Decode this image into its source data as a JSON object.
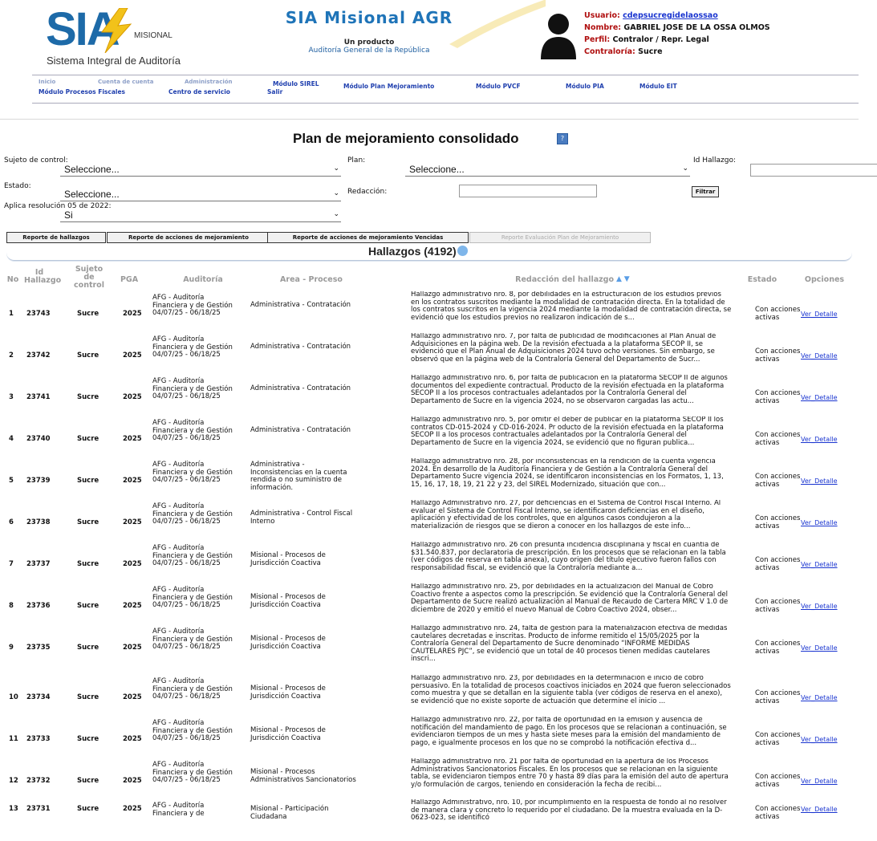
{
  "header": {
    "logo_text": "SIA",
    "logo_misional": "MISIONAL",
    "logo_subtitle": "Sistema Integral de Auditoría",
    "app_title": "SIA Misional AGR",
    "app_sub1": "Un producto",
    "app_sub2": "Auditoría General de la República",
    "user": {
      "usuario_label": "Usuario:",
      "usuario_value": "cdepsucregidelaossao",
      "nombre_label": "Nombre:",
      "nombre_value": "GABRIEL JOSE DE LA OSSA OLMOS",
      "perfil_label": "Perfil:",
      "perfil_value": "Contralor / Repr. Legal",
      "contraloria_label": "Contraloría:",
      "contraloria_value": "Sucre"
    }
  },
  "nav": {
    "row1": [
      "Inicio",
      "Cuenta de cuenta",
      "Administración",
      "Módulo SIREL",
      "Módulo Plan Mejoramiento",
      "Módulo PVCF",
      "Módulo PIA",
      "Módulo EIT"
    ],
    "row2": [
      "Módulo Procesos Fiscales",
      "Centro de servicio",
      "Salir"
    ]
  },
  "page": {
    "title": "Plan de mejoramiento consolidado"
  },
  "filters": {
    "sujeto_label": "Sujeto de control:",
    "sujeto_value": "Seleccione...",
    "plan_label": "Plan:",
    "plan_value": "Seleccione...",
    "id_hallazgo_label": "Id Hallazgo:",
    "estado_label": "Estado:",
    "estado_value": "Seleccione...",
    "redaccion_label": "Redacción:",
    "filtrar_label": "Filtrar",
    "aplica_label": "Aplica resolución 05 de 2022:",
    "aplica_value": "Si"
  },
  "buttons": {
    "reporte_hallazgos": "Reporte de hallazgos",
    "reporte_acciones": "Reporte de acciones de mejoramiento",
    "reporte_vencidas": "Reporte de acciones de mejoramiento Vencidas",
    "reporte_evaluacion": "Reporte Evaluación Plan de Mejoramiento"
  },
  "section": {
    "title": "Hallazgos (4192)"
  },
  "table": {
    "headers": {
      "no": "No",
      "id": "Id Hallazgo",
      "sujeto": "Sujeto de control",
      "pga": "PGA",
      "auditoria": "Auditoría",
      "area": "Area - Proceso",
      "redaccion": "Redacción del hallazgo",
      "estado": "Estado",
      "opciones": "Opciones"
    },
    "rows": [
      {
        "no": "1",
        "id": "23743",
        "sujeto": "Sucre",
        "pga": "2025",
        "auditoria": "AFG - Auditoría Financiera y de Gestión 04/07/25 - 06/18/25",
        "area": "Administrativa - Contratación",
        "redaccion": "Hallazgo administrativo nro. 8, por debilidades en la estructuración de los estudios previos en los contratos suscritos mediante la modalidad de contratación directa. En la totalidad de los contratos suscritos en la vigencia 2024 mediante la modalidad de contratación directa, se evidenció que los estudios previos no realizaron indicación de s...",
        "estado": "Con acciones activas",
        "opcion": "Ver_Detalle"
      },
      {
        "no": "2",
        "id": "23742",
        "sujeto": "Sucre",
        "pga": "2025",
        "auditoria": "AFG - Auditoría Financiera y de Gestión 04/07/25 - 06/18/25",
        "area": "Administrativa - Contratación",
        "redaccion": "Hallazgo administrativo nro. 7, por falta de publicidad de modificaciones al Plan Anual de Adquisiciones en la página web. De la revisión efectuada a la plataforma SECOP II, se evidenció que el Plan Anual de Adquisiciones 2024 tuvo ocho versiones. Sin embargo, se observó que en la página web de la Contraloría General del Departamento de Sucr...",
        "estado": "Con acciones activas",
        "opcion": "Ver_Detalle"
      },
      {
        "no": "3",
        "id": "23741",
        "sujeto": "Sucre",
        "pga": "2025",
        "auditoria": "AFG - Auditoría Financiera y de Gestión 04/07/25 - 06/18/25",
        "area": "Administrativa - Contratación",
        "redaccion": "Hallazgo administrativo nro. 6, por falta de publicación en la plataforma SECOP II de algunos documentos del expediente contractual. Producto de la revisión efectuada en la plataforma SECOP II a los procesos contractuales adelantados por la Contraloría General del Departamento de Sucre en la vigencia 2024, no se observaron cargadas las actu...",
        "estado": "Con acciones activas",
        "opcion": "Ver_Detalle"
      },
      {
        "no": "4",
        "id": "23740",
        "sujeto": "Sucre",
        "pga": "2025",
        "auditoria": "AFG - Auditoría Financiera y de Gestión 04/07/25 - 06/18/25",
        "area": "Administrativa - Contratación",
        "redaccion": "Hallazgo administrativo nro. 5, por omitir el deber de publicar en la plataforma SECOP II los contratos CD-015-2024 y CD-016-2024. Pr oducto de la revisión efectuada en la plataforma SECOP II a los procesos contractuales adelantados por la Contraloría General del Departamento de Sucre en la vigencia 2024, se evidenció que no figuran publica...",
        "estado": "Con acciones activas",
        "opcion": "Ver_Detalle"
      },
      {
        "no": "5",
        "id": "23739",
        "sujeto": "Sucre",
        "pga": "2025",
        "auditoria": "AFG - Auditoría Financiera y de Gestión 04/07/25 - 06/18/25",
        "area": "Administrativa - Inconsistencias en la cuenta rendida o no suministro de información.",
        "redaccion": "Hallazgo administrativo nro. 28, por inconsistencias en la rendición de la cuenta vigencia 2024. En desarrollo de la Auditoría Financiera y de Gestión a la Contraloría General del Departamento Sucre vigencia 2024, se identificaron inconsistencias en los Formatos, 1, 13, 15, 16, 17, 18, 19, 21 22 y 23, del SIREL Modernizado, situación que con...",
        "estado": "Con acciones activas",
        "opcion": "Ver_Detalle"
      },
      {
        "no": "6",
        "id": "23738",
        "sujeto": "Sucre",
        "pga": "2025",
        "auditoria": "AFG - Auditoría Financiera y de Gestión 04/07/25 - 06/18/25",
        "area": "Administrativa - Control Fiscal Interno",
        "redaccion": "Hallazgo Administrativo nro. 27, por deficiencias en el Sistema de Control Fiscal Interno. Al evaluar el Sistema de Control Fiscal Interno, se identificaron deficiencias en el diseño, aplicación y efectividad de los controles, que en algunos casos condujeron a la materialización de riesgos que se dieron a conocer en los hallazgos de este info...",
        "estado": "Con acciones activas",
        "opcion": "Ver_Detalle"
      },
      {
        "no": "7",
        "id": "23737",
        "sujeto": "Sucre",
        "pga": "2025",
        "auditoria": "AFG - Auditoría Financiera y de Gestión 04/07/25 - 06/18/25",
        "area": "Misional - Procesos de Jurisdicción Coactiva",
        "redaccion": "Hallazgo administrativo nro. 26 con presunta incidencia disciplinaria y fiscal en cuantía de $31.540.837, por declaratoria de prescripción. En los procesos que se relacionan en la tabla (ver códigos de reserva en tabla anexa), cuyo origen del título ejecutivo fueron fallos con responsabilidad fiscal, se evidenció que la Contraloría mediante a...",
        "estado": "Con acciones activas",
        "opcion": "Ver_Detalle"
      },
      {
        "no": "8",
        "id": "23736",
        "sujeto": "Sucre",
        "pga": "2025",
        "auditoria": "AFG - Auditoría Financiera y de Gestión 04/07/25 - 06/18/25",
        "area": "Misional - Procesos de Jurisdicción Coactiva",
        "redaccion": "Hallazgo administrativo nro. 25, por debilidades en la actualización del Manual de Cobro Coactivo frente a aspectos como la prescripción. Se evidenció que la Contraloría General del Departamento de Sucre realizó actualización al Manual de Recaudo de Cartera MRC V 1.0 de diciembre de 2020 y emitió el nuevo Manual de Cobro Coactivo 2024, obser...",
        "estado": "Con acciones activas",
        "opcion": "Ver_Detalle"
      },
      {
        "no": "9",
        "id": "23735",
        "sujeto": "Sucre",
        "pga": "2025",
        "auditoria": "AFG - Auditoría Financiera y de Gestión 04/07/25 - 06/18/25",
        "area": "Misional - Procesos de Jurisdicción Coactiva",
        "redaccion": "Hallazgo administrativo nro. 24, falta de gestión para la materialización efectiva de medidas cautelares decretadas e inscritas. Producto de informe remitido el 15/05/2025 por la Contraloría General del Departamento de Sucre denominado “INFORME MEDIDAS CAUTELARES PJC”, se evidenció que un total de 40 procesos tienen medidas cautelares inscri...",
        "estado": "Con acciones activas",
        "opcion": "Ver_Detalle"
      },
      {
        "no": "10",
        "id": "23734",
        "sujeto": "Sucre",
        "pga": "2025",
        "auditoria": "AFG - Auditoría Financiera y de Gestión 04/07/25 - 06/18/25",
        "area": "Misional - Procesos de Jurisdicción Coactiva",
        "redaccion": "Hallazgo administrativo nro. 23, por debilidades en la determinación e inicio de cobro persuasivo. En la totalidad de procesos coactivos iniciados en 2024 que fueron seleccionados como muestra y que se detallan en la siguiente tabla (ver códigos de reserva en el anexo), se evidenció que no existe soporte de actuación que determine el inicio ...",
        "estado": "Con acciones activas",
        "opcion": "Ver_Detalle"
      },
      {
        "no": "11",
        "id": "23733",
        "sujeto": "Sucre",
        "pga": "2025",
        "auditoria": "AFG - Auditoría Financiera y de Gestión 04/07/25 - 06/18/25",
        "area": "Misional - Procesos de Jurisdicción Coactiva",
        "redaccion": "Hallazgo administrativo nro. 22, por falta de oportunidad en la emisión y ausencia de notificación del mandamiento de pago. En los procesos que se relacionan a continuación, se evidenciaron tiempos de un mes y hasta siete meses para la emisión del mandamiento de pago, e igualmente procesos en los que no se comprobó la notificación efectiva d...",
        "estado": "Con acciones activas",
        "opcion": "Ver_Detalle"
      },
      {
        "no": "12",
        "id": "23732",
        "sujeto": "Sucre",
        "pga": "2025",
        "auditoria": "AFG - Auditoría Financiera y de Gestión 04/07/25 - 06/18/25",
        "area": "Misional - Procesos Administrativos Sancionatorios",
        "redaccion": "Hallazgo administrativo nro. 21 por falta de oportunidad en la apertura de los Procesos Administrativos Sancionatorios Fiscales. En los procesos que se relacionan en la siguiente tabla, se evidenciaron tiempos entre 70 y hasta 89 días para la emisión del auto de apertura y/o formulación de cargos, teniendo en consideración la fecha de recibi...",
        "estado": "Con acciones activas",
        "opcion": "Ver_Detalle"
      },
      {
        "no": "13",
        "id": "23731",
        "sujeto": "Sucre",
        "pga": "2025",
        "auditoria": "AFG - Auditoría Financiera y de",
        "area": "Misional - Participación Ciudadana",
        "redaccion": "Hallazgo Administrativo, nro. 10, por incumplimiento en la respuesta de fondo al no resolver de manera clara y concreto lo requerido por el ciudadano. De la muestra evaluada en la D-0623-023, se identificó",
        "estado": "Con acciones activas",
        "opcion": "Ver_Detalle"
      }
    ]
  }
}
